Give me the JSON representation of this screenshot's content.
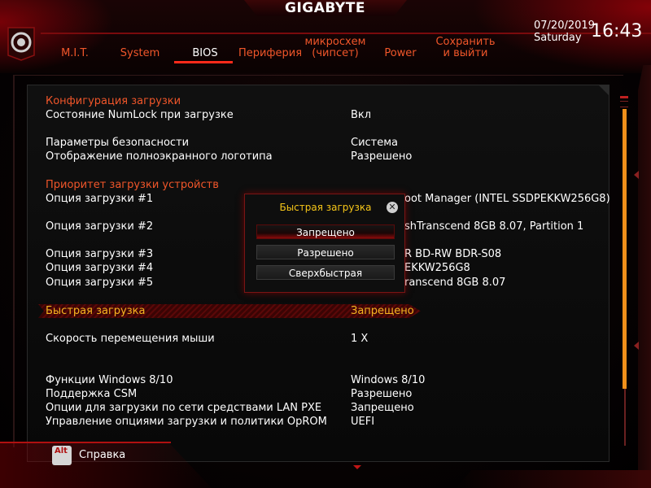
{
  "header": {
    "brand": "GIGABYTE",
    "date": "07/20/2019",
    "day": "Saturday",
    "time": "16:43",
    "tabs": [
      {
        "label": "M.I.T."
      },
      {
        "label": "System"
      },
      {
        "label": "BIOS"
      },
      {
        "label": "Периферия"
      },
      {
        "label": "микросхем (чипсет)"
      },
      {
        "label": "Power"
      },
      {
        "label": "Сохранить и выйти"
      }
    ],
    "active_tab": "BIOS"
  },
  "settings": {
    "boot_config_header": "Конфигурация загрузки",
    "numlock": {
      "label": "Состояние NumLock при загрузке",
      "value": "Вкл"
    },
    "security": {
      "label": "Параметры безопасности",
      "value": "Система"
    },
    "fullscreen_logo": {
      "label": "Отображение полноэкранного логотипа",
      "value": "Разрешено"
    },
    "boot_priority_header": "Приоритет загрузки устройств",
    "boot_options": [
      {
        "label": "Опция загрузки #1",
        "value": "oot Manager (INTEL SSDPEKKW256G8)"
      },
      {
        "label": "Опция загрузки #2",
        "value": "shTranscend 8GB 8.07, Partition 1"
      },
      {
        "label": "Опция загрузки #3",
        "value": "R BD-RW   BDR-S08"
      },
      {
        "label": "Опция загрузки #4",
        "value": "EKKW256G8"
      },
      {
        "label": "Опция загрузки #5",
        "value": "ranscend 8GB 8.07"
      }
    ],
    "fast_boot": {
      "label": "Быстрая загрузка",
      "value": "Запрещено"
    },
    "mouse_speed": {
      "label": "Скорость перемещения мыши",
      "value": "1 X"
    },
    "windows_features": {
      "label": "Функции Windows 8/10",
      "value": "Windows 8/10"
    },
    "csm": {
      "label": "Поддержка CSM",
      "value": "Разрешено"
    },
    "lan_pxe": {
      "label": "Опции для загрузки по сети средствами LAN PXE",
      "value": "Запрещено"
    },
    "oprom": {
      "label": "Управление опциями загрузки и политики OpROM",
      "value": "UEFI"
    }
  },
  "popup": {
    "title": "Быстрая загрузка",
    "close_glyph": "✕",
    "options": [
      {
        "label": "Запрещено",
        "selected": true
      },
      {
        "label": "Разрешено",
        "selected": false
      },
      {
        "label": "Сверхбыстрая",
        "selected": false
      }
    ]
  },
  "footer": {
    "alt_key": "Alt",
    "help_label": "Справка"
  },
  "colors": {
    "section": "#f0562a",
    "selected": "#f5b520",
    "accent_red": "#c01515",
    "scrollbar": "#f0901a"
  }
}
